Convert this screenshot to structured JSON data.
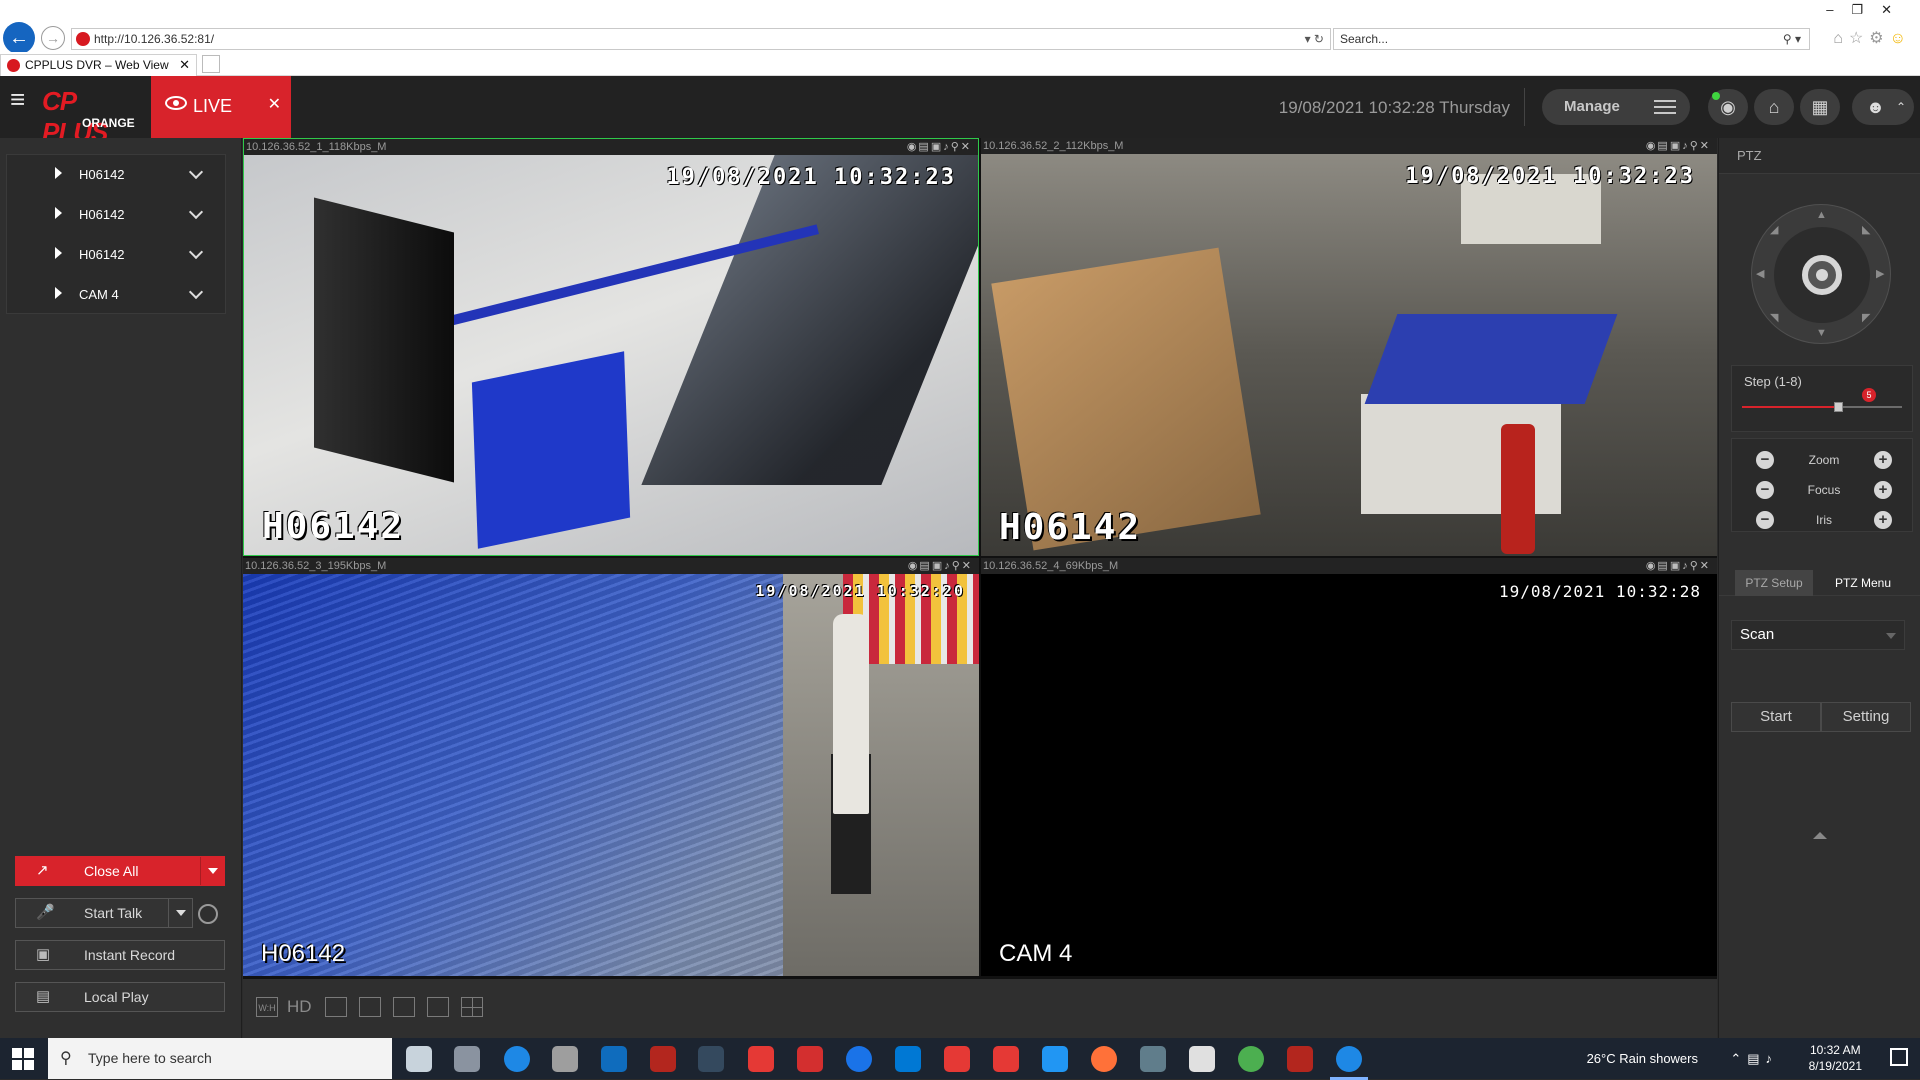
{
  "browser": {
    "url": "http://10.126.36.52:81/",
    "search_placeholder": "Search...",
    "tab_title": "CPPLUS DVR – Web View"
  },
  "app": {
    "logo": {
      "brand": "CP PLUS",
      "sub": "ORANGE"
    },
    "live_tab": "LIVE",
    "datetime": "19/08/2021 10:32:28 Thursday",
    "manage_label": "Manage"
  },
  "cameras": [
    {
      "name": "H06142"
    },
    {
      "name": "H06142"
    },
    {
      "name": "H06142"
    },
    {
      "name": "CAM 4"
    }
  ],
  "left_buttons": {
    "close_all": "Close All",
    "start_talk": "Start Talk",
    "instant_record": "Instant Record",
    "local_play": "Local Play"
  },
  "tiles": [
    {
      "stream": "10.126.36.52_1_118Kbps_M",
      "osd_time": "19/08/2021 10:32:23",
      "osd_name": "H06142"
    },
    {
      "stream": "10.126.36.52_2_112Kbps_M",
      "osd_time": "19/08/2021 10:32:23",
      "osd_name": "H06142"
    },
    {
      "stream": "10.126.36.52_3_195Kbps_M",
      "osd_time": "19/08/2021 10:32:20",
      "osd_name": "H06142"
    },
    {
      "stream": "10.126.36.52_4_69Kbps_M",
      "osd_time": "19/08/2021 10:32:28",
      "osd_name": "CAM 4"
    }
  ],
  "grid_toolbar": {
    "wh": "W:H",
    "hd": "HD"
  },
  "ptz": {
    "title": "PTZ",
    "step_label": "Step (1-8)",
    "step_value": "5",
    "step_fraction": 0.6,
    "controls": [
      "Zoom",
      "Focus",
      "Iris"
    ],
    "tab_setup": "PTZ Setup",
    "tab_menu": "PTZ Menu",
    "scan_value": "Scan",
    "start_label": "Start",
    "setting_label": "Setting"
  },
  "taskbar": {
    "search_placeholder": "Type here to search",
    "weather": "26°C  Rain showers",
    "time": "10:32 AM",
    "date": "8/19/2021"
  },
  "colors": {
    "accent_red": "#d8232b",
    "selected_green": "#2fc94a",
    "header_bg": "#222222"
  }
}
